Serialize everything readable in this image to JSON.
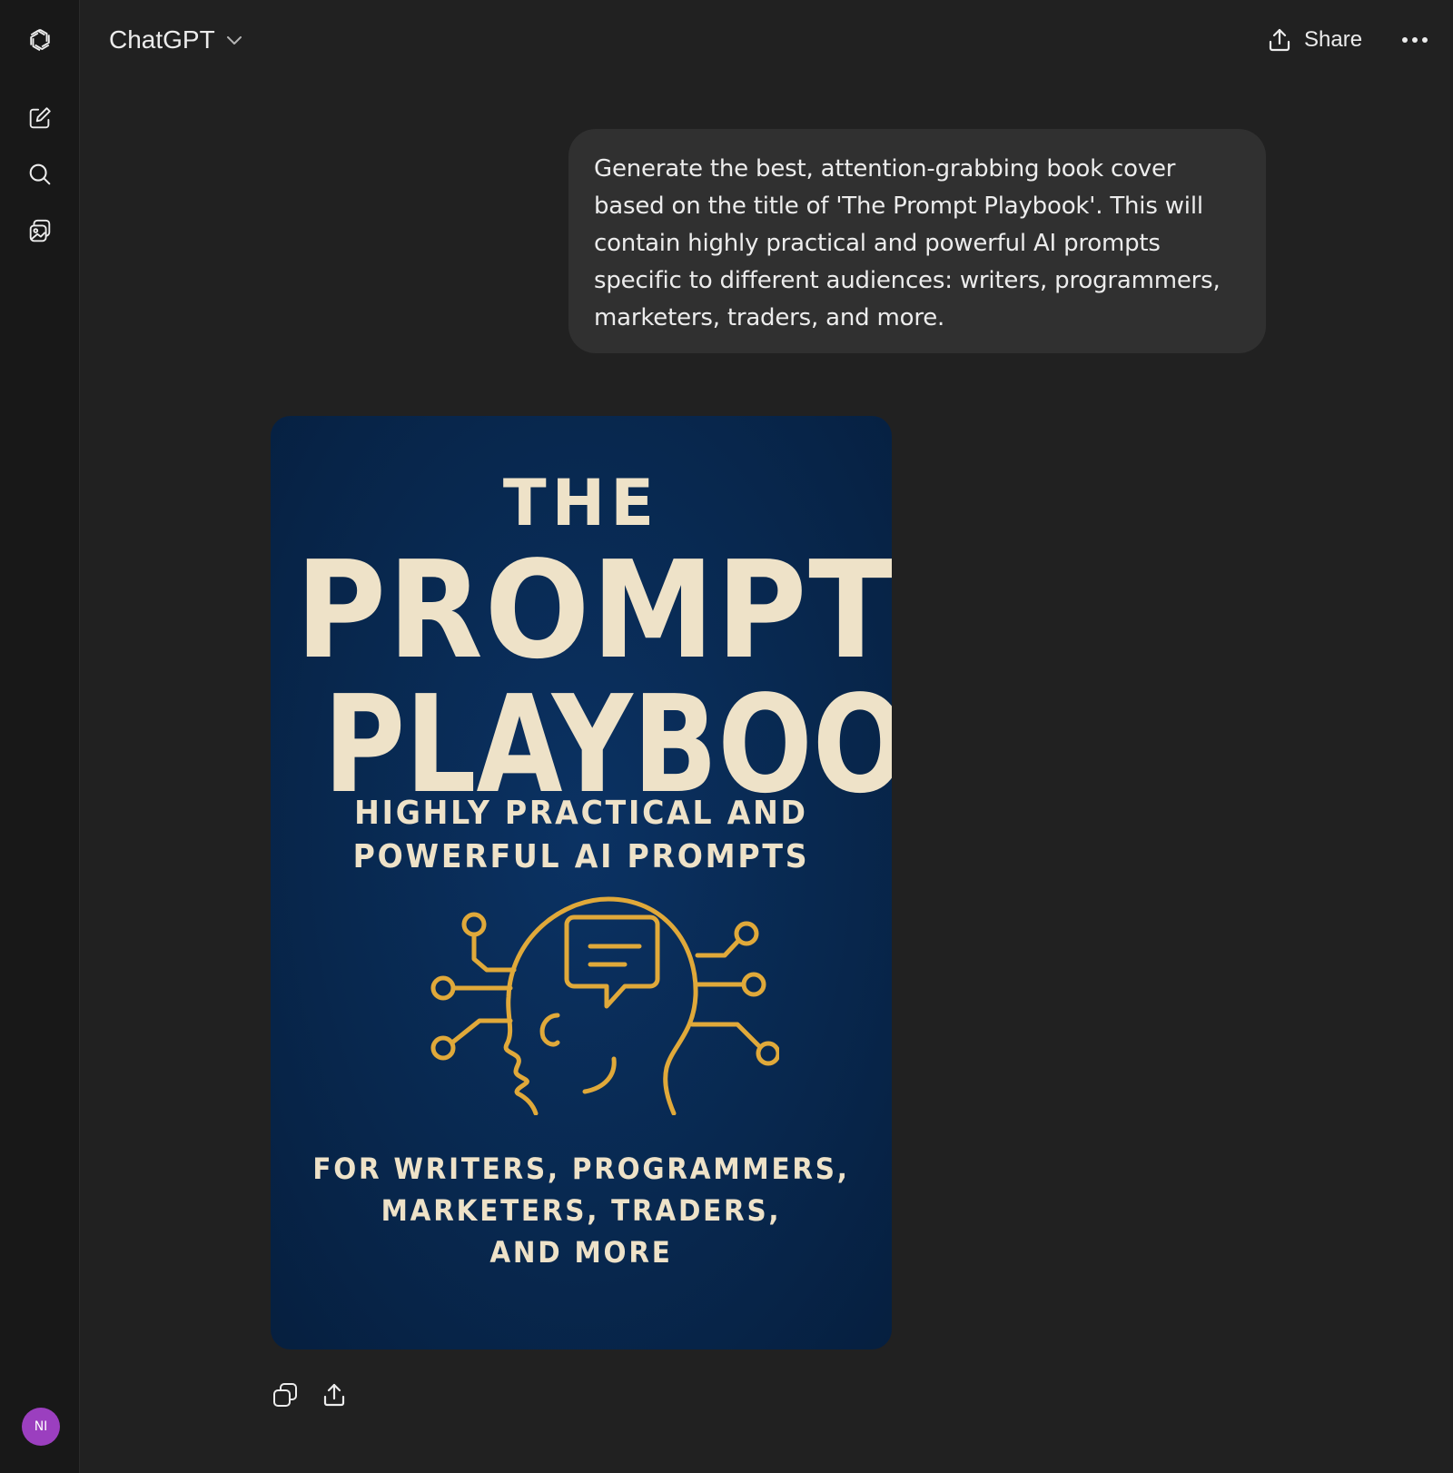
{
  "sidebar": {
    "items": [
      {
        "name": "new-chat",
        "icon": "edit-icon"
      },
      {
        "name": "search",
        "icon": "search-icon"
      },
      {
        "name": "library",
        "icon": "images-icon"
      }
    ],
    "avatar_initials": "NI"
  },
  "header": {
    "model_name": "ChatGPT",
    "share_label": "Share"
  },
  "conversation": {
    "user_message": "Generate the best, attention-grabbing book cover based on the title of 'The Prompt Playbook'. This will contain highly practical and powerful AI prompts specific to different audiences: writers, programmers, marketers, traders, and more.",
    "generated_cover": {
      "line_the": "THE",
      "line_prompt": "PROMPT",
      "line_playbook": "PLAYBOOK",
      "subtitle_line1": "HIGHLY PRACTICAL AND",
      "subtitle_line2": "POWERFUL AI PROMPTS",
      "audience_line1": "FOR WRITERS, PROGRAMMERS,",
      "audience_line2": "MARKETERS, TRADERS,",
      "audience_line3": "AND MORE",
      "colors": {
        "background": "#08284f",
        "text": "#eee2c8",
        "accent": "#e0a93a"
      }
    }
  },
  "actions": {
    "icons": [
      "copy-icon",
      "share-icon"
    ]
  }
}
